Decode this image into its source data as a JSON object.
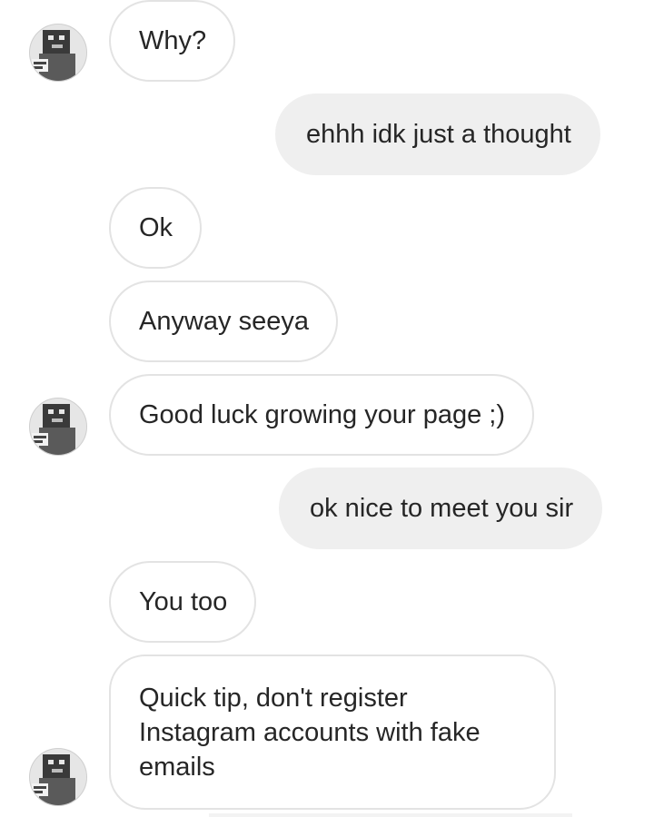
{
  "messages": [
    {
      "side": "in",
      "text": "Why?"
    },
    {
      "side": "out",
      "text": "ehhh idk just a thought"
    },
    {
      "side": "in",
      "text": "Ok"
    },
    {
      "side": "in",
      "text": "Anyway seeya"
    },
    {
      "side": "in",
      "text": "Good luck growing your page ;)"
    },
    {
      "side": "out",
      "text": "ok nice to meet you sir"
    },
    {
      "side": "in",
      "text": "You too"
    },
    {
      "side": "in",
      "lines": [
        "Quick tip, don't register",
        "Instagram accounts with fake",
        "emails"
      ]
    }
  ],
  "avatar": {
    "icon": "user-avatar-icon"
  },
  "colors": {
    "incoming_bubble_bg": "#ffffff",
    "incoming_bubble_border": "#e3e3e3",
    "outgoing_bubble_bg": "#efefef",
    "text": "#262626"
  }
}
